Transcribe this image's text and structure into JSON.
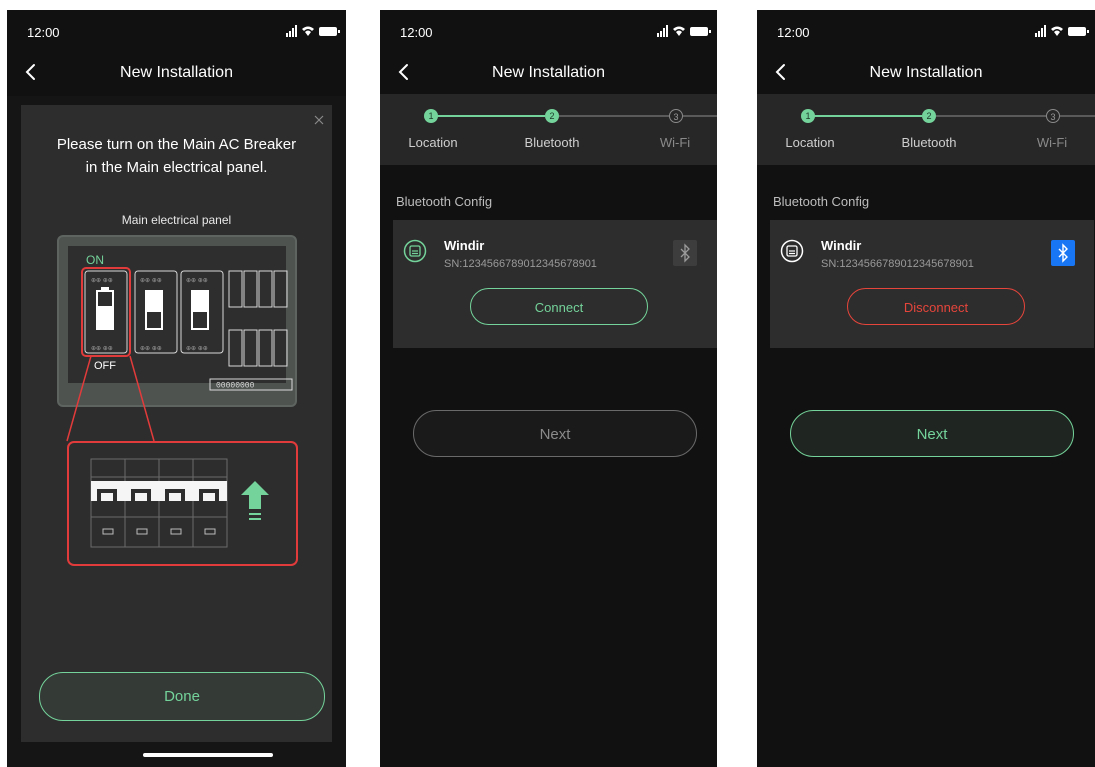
{
  "colors": {
    "accent": "#74d39a",
    "danger": "#e6453b",
    "bluetooth_active": "#1876f5",
    "background": "#111111",
    "card": "#2d2d2d"
  },
  "status_bar": {
    "time": "12:00"
  },
  "nav": {
    "title": "New Installation",
    "back_icon": "chevron-left-icon"
  },
  "screen1": {
    "modal": {
      "title_line1": "Please turn on the Main AC Breaker",
      "title_line2": "in the Main electrical panel.",
      "panel_label": "Main electrical panel",
      "on_label": "ON",
      "off_label": "OFF",
      "meter_digits": "00000000",
      "close_icon": "close-icon",
      "done_label": "Done"
    }
  },
  "steps": [
    {
      "number": "1",
      "label": "Location"
    },
    {
      "number": "2",
      "label": "Bluetooth"
    },
    {
      "number": "3",
      "label": "Wi-Fi"
    }
  ],
  "screen2": {
    "section_label": "Bluetooth Config",
    "device": {
      "name": "Windir",
      "sn": "SN:12345667890123456789​01"
    },
    "action_label": "Connect",
    "bluetooth_state": "off",
    "next_label": "Next",
    "next_enabled": false
  },
  "screen3": {
    "section_label": "Bluetooth Config",
    "device": {
      "name": "Windir",
      "sn": "SN:12345667890123456789​01"
    },
    "action_label": "Disconnect",
    "bluetooth_state": "on",
    "next_label": "Next",
    "next_enabled": true
  }
}
